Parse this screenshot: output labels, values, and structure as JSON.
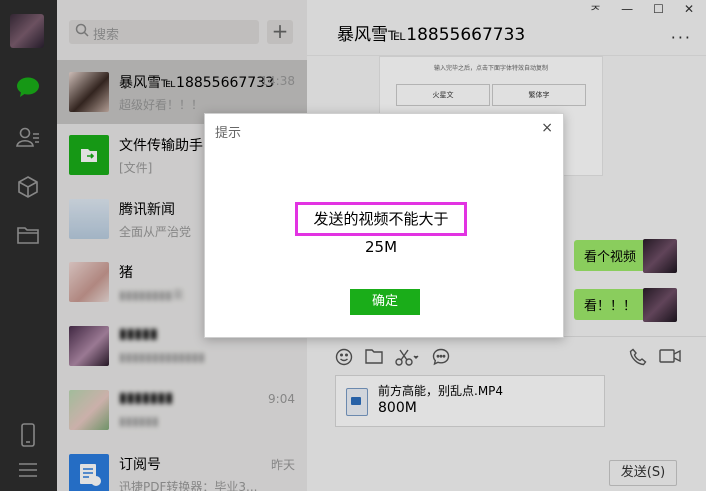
{
  "search": {
    "placeholder": "搜索"
  },
  "contacts": [
    {
      "name": "暴风雪℡18855667733",
      "preview": "超级好看！！！",
      "time": "14:38",
      "selected": true,
      "avatar": "portrait-dark"
    },
    {
      "name": "文件传输助手",
      "preview": "[文件]",
      "time": "",
      "selected": false,
      "avatar": "file-transfer"
    },
    {
      "name": "腾讯新闻",
      "preview": "全面从严治党",
      "time": "",
      "selected": false,
      "avatar": "news"
    },
    {
      "name": "猪",
      "preview": "▮▮▮▮▮▮▮▮来",
      "time": "",
      "selected": false,
      "avatar": "portrait-pink"
    },
    {
      "name": "▮▮▮▮▮",
      "preview": "▮▮▮▮▮▮▮▮▮▮▮▮▮",
      "time": "",
      "selected": false,
      "avatar": "portrait-purple"
    },
    {
      "name": "▮▮▮▮▮▮▮",
      "preview": "▮▮▮▮▮▮",
      "time": "9:04",
      "selected": false,
      "avatar": "portrait-green"
    },
    {
      "name": "订阅号",
      "preview": "迅捷PDF转换器：毕业3...",
      "time": "昨天",
      "selected": false,
      "avatar": "subscription"
    }
  ],
  "chat": {
    "title": "暴风雪℡18855667733",
    "window_controls": [
      "ᅎ",
      "—",
      "☐",
      "✕"
    ],
    "more": "···",
    "screenshot_card": {
      "hint": "输入完毕之后，点击下面字体特效自动复制",
      "buttons": [
        "火星文",
        "繁体字"
      ]
    },
    "messages": [
      {
        "text": "看个视频",
        "side": "right"
      },
      {
        "text": "看！！！",
        "side": "right"
      }
    ],
    "toolbar_icons": [
      "emoji-icon",
      "folder-icon",
      "scissors-icon",
      "chat-bubble-icon",
      "phone-icon",
      "video-icon"
    ],
    "attachment": {
      "filename": "前方高能，别乱点.MP4",
      "size": "800M"
    },
    "send_label": "发送(S)"
  },
  "dialog": {
    "title": "提示",
    "message": "发送的视频不能大于25M",
    "ok_label": "确定",
    "close": "×"
  },
  "colors": {
    "accent": "#1aad19",
    "bubble": "#9eea6a",
    "highlight": "#e233e2",
    "sidebar": "#2e2e2e"
  }
}
